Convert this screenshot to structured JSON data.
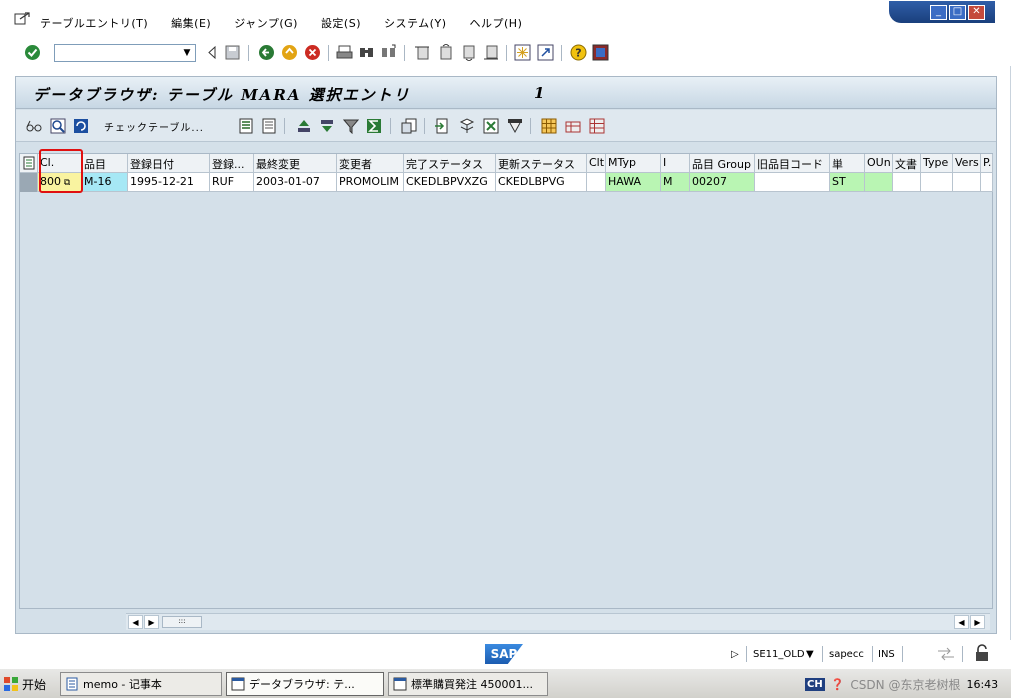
{
  "menu": {
    "items": [
      "テーブルエントリ(T)",
      "編集(E)",
      "ジャンプ(G)",
      "設定(S)",
      "システム(Y)",
      "ヘルプ(H)"
    ]
  },
  "title": {
    "text": "データブラウザ: テーブル MARA 選択エントリ",
    "count": "1"
  },
  "toolbar": {
    "check_table_label": "チェックテーブル..."
  },
  "grid": {
    "columns": [
      {
        "label": "Cl.",
        "width": 44
      },
      {
        "label": "品目",
        "width": 46
      },
      {
        "label": "登録日付",
        "width": 82
      },
      {
        "label": "登録...",
        "width": 44
      },
      {
        "label": "最終変更",
        "width": 83
      },
      {
        "label": "変更者",
        "width": 67
      },
      {
        "label": "完了ステータス",
        "width": 92
      },
      {
        "label": "更新ステータス",
        "width": 91
      },
      {
        "label": "Clt",
        "width": 19
      },
      {
        "label": "MTyp",
        "width": 55
      },
      {
        "label": "I",
        "width": 29
      },
      {
        "label": "品目 Group",
        "width": 65
      },
      {
        "label": "旧品目コード",
        "width": 75
      },
      {
        "label": "単",
        "width": 35
      },
      {
        "label": "OUn",
        "width": 28
      },
      {
        "label": "文書",
        "width": 28
      },
      {
        "label": "Type",
        "width": 32
      },
      {
        "label": "Vers",
        "width": 28
      },
      {
        "label": "P.",
        "width": 12
      }
    ],
    "rows": [
      [
        "800",
        "M-16",
        "1995-12-21",
        "RUF",
        "2003-01-07",
        "PROMOLIM",
        "CKEDLBPVXZG",
        "CKEDLBPVG",
        "",
        "HAWA",
        "M",
        "00207",
        "",
        "ST",
        "",
        "",
        "",
        "",
        ""
      ]
    ]
  },
  "status": {
    "system": "SE11_OLD",
    "server": "sapecc",
    "mode": "INS"
  },
  "taskbar": {
    "start": "开始",
    "tasks": [
      "memo - 记事本",
      "データブラウザ: テ...",
      "標準購買発注 450001..."
    ],
    "lang": "CH",
    "clock": "16:43",
    "watermark": "CSDN @东京老树根"
  },
  "colors": {
    "accent": "#1a3f7c",
    "highlight": "#e01010",
    "key_cell": "#a6e8f5",
    "green_cell": "#b9f5b3"
  }
}
